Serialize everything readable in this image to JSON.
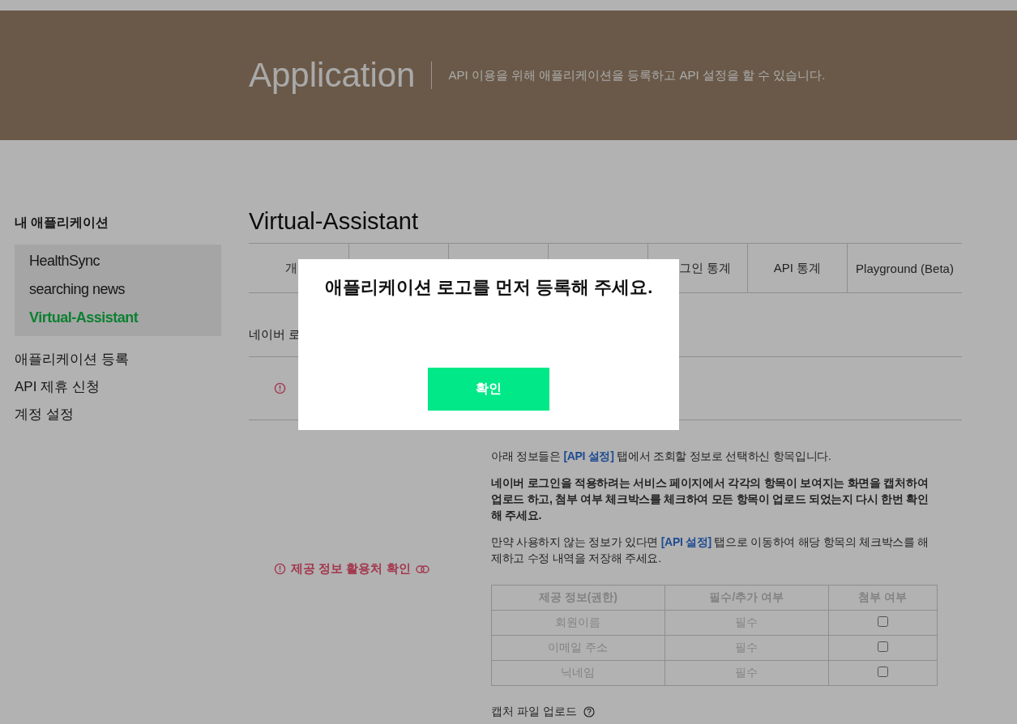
{
  "header": {
    "title": "Application",
    "subtitle": "API 이용을 위해 애플리케이션을 등록하고 API 설정을 할 수 있습니다."
  },
  "sidebar": {
    "title": "내 애플리케이션",
    "apps": [
      {
        "label": "HealthSync",
        "selected": false
      },
      {
        "label": "searching news",
        "selected": false
      },
      {
        "label": "Virtual-Assistant",
        "selected": true
      }
    ],
    "links": [
      "애플리케이션 등록",
      "API 제휴 신청",
      "계정 설정"
    ]
  },
  "app_title": "Virtual-Assistant",
  "tabs": [
    {
      "label": "개",
      "kind": "tail"
    },
    {
      "kind": "hidden"
    },
    {
      "kind": "hidden"
    },
    {
      "kind": "hidden"
    },
    {
      "label": "그인 통계",
      "kind": "head"
    },
    {
      "label": "API 통계",
      "kind": "plain"
    },
    {
      "label": "Playground (Beta)",
      "kind": "plain"
    }
  ],
  "notice": "네이버 로",
  "section": {
    "label": "제공 정보 활용처 확인",
    "paragraphs": [
      {
        "emphasis": false,
        "parts": [
          {
            "text": "아래 정보들은 "
          },
          {
            "text": "[API 설정]",
            "kind": "link"
          },
          {
            "text": " 탭에서 조회할 정보로 선택하신 항목입니다."
          }
        ]
      },
      {
        "emphasis": true,
        "parts": [
          {
            "text": "네이버 로그인을 적용하려는 서비스 페이지에서 각각의 항목이 보여지는 화면을 캡처하여 업로드 하고, 첨부 여부 체크박스를 체크하여 모든 항목이 업로드 되었는지 다시 한번 확인해 주세요."
          }
        ]
      },
      {
        "emphasis": false,
        "parts": [
          {
            "text": "만약 사용하지 않는 정보가 있다면 "
          },
          {
            "text": "[API 설정]",
            "kind": "link"
          },
          {
            "text": " 탭으로 이동하여 해당 항목의 체크박스를 해제하고 수정 내역을 저장해 주세요."
          }
        ]
      }
    ],
    "table": {
      "columns": [
        "제공 정보(권한)",
        "필수/추가 여부",
        "첨부 여부"
      ],
      "rows": [
        {
          "name": "회원이름",
          "required": "필수",
          "attached": false
        },
        {
          "name": "이메일 주소",
          "required": "필수",
          "attached": false
        },
        {
          "name": "닉네임",
          "required": "필수",
          "attached": false
        }
      ]
    },
    "upload_label": "캡처 파일 업로드"
  },
  "modal": {
    "message": "애플리케이션 로고를 먼저 등록해 주세요.",
    "button": "확인"
  }
}
